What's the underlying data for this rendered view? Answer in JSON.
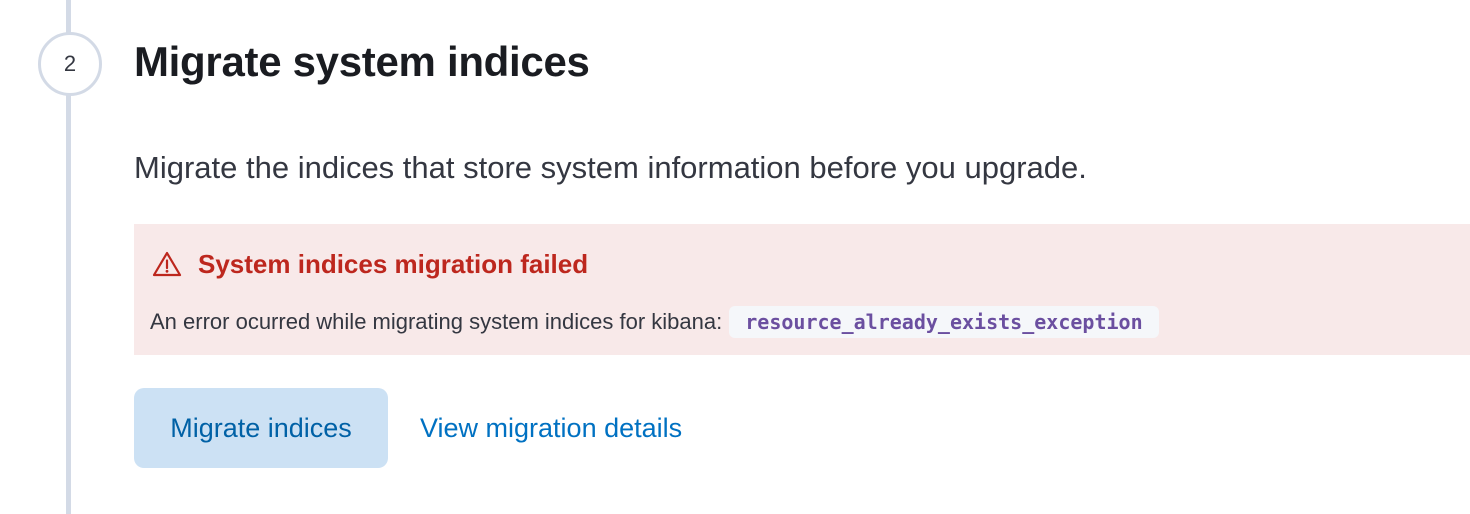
{
  "step": {
    "number": "2",
    "title": "Migrate system indices",
    "description": "Migrate the indices that store system information before you upgrade."
  },
  "callout": {
    "icon": "alert-icon",
    "title": "System indices migration failed",
    "message": "An error ocurred while migrating system indices for kibana:",
    "error_code": "resource_already_exists_exception"
  },
  "actions": {
    "migrate_label": "Migrate indices",
    "details_label": "View migration details"
  },
  "colors": {
    "danger": "#bd271e",
    "danger_bg": "#f8e9e9",
    "primary": "#0071c2",
    "primary_bg": "#cce1f4",
    "step_border": "#d3dae6",
    "code_text": "#6b4fa0"
  }
}
